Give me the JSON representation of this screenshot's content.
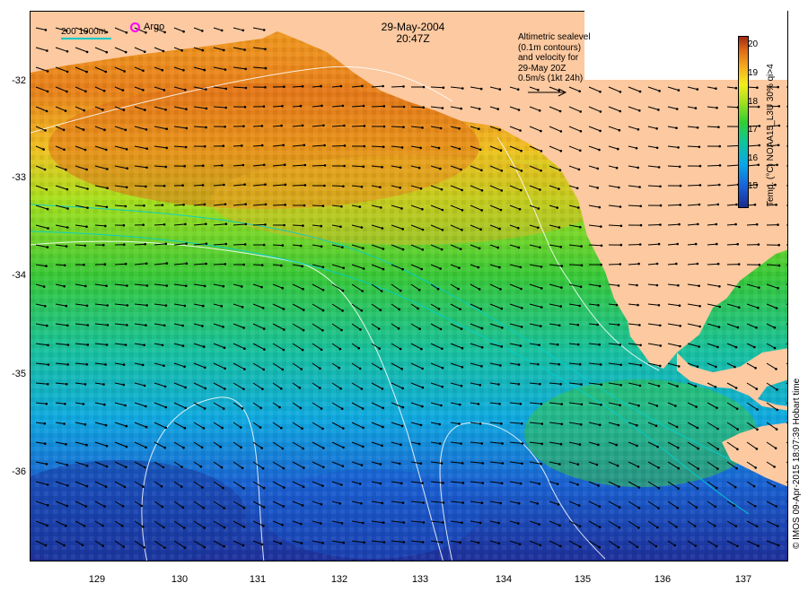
{
  "title": {
    "date": "29-May-2004",
    "time": "20:47Z"
  },
  "legend": {
    "depth_contours": "200  1000m",
    "argo": "Argo",
    "argo_color": "#ff00ff",
    "depth_color": "#00c8c8"
  },
  "altimetry_note": [
    "Altimetric sealevel",
    "(0.1m contours)",
    "and velocity for",
    "29-May 20Z",
    "0.5m/s (1kt 24h)"
  ],
  "x_axis": {
    "ticks": [
      "129",
      "130",
      "131",
      "132",
      "133",
      "134",
      "135",
      "136",
      "137"
    ]
  },
  "y_axis": {
    "ticks": [
      "-32",
      "-33",
      "-34",
      "-35",
      "-36"
    ]
  },
  "colorbar": {
    "label": "Temp. (°C) NOAA15_L3U 30% qi>4",
    "ticks": [
      "20",
      "19",
      "18",
      "17",
      "16",
      "15"
    ],
    "range": [
      14.2,
      20.4
    ],
    "colors": [
      "#1e2a8c",
      "#1a5fd6",
      "#0aa6e8",
      "#10c49a",
      "#32d030",
      "#a8e01e",
      "#f4ee1c",
      "#f5ae20",
      "#e06a18",
      "#a02a14"
    ]
  },
  "land_color": "#fcc9a0",
  "credit": "© IMOS 09-Apr-2015 18:07:39 Hobart time"
}
